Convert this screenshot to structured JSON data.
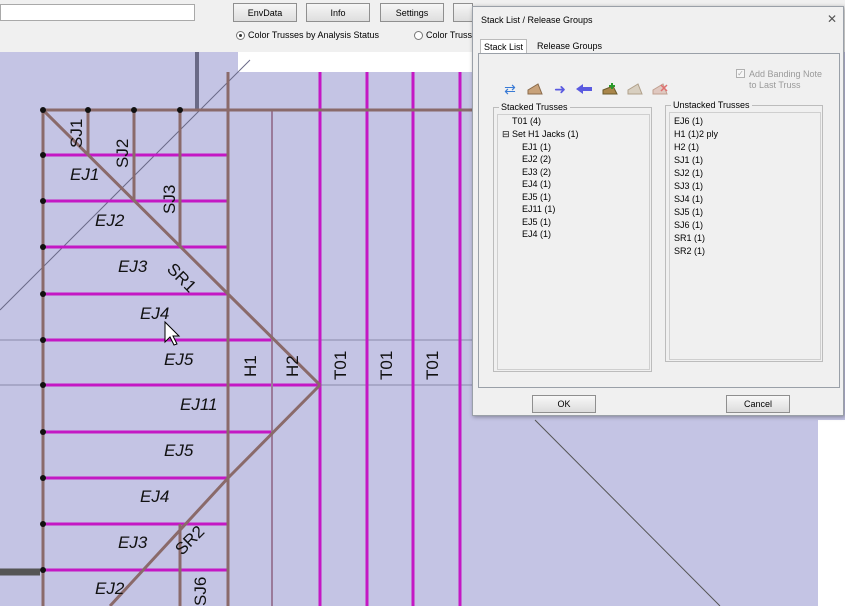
{
  "toolbar": {
    "search_value": "",
    "buttons": [
      "EnvData",
      "Info",
      "Settings"
    ],
    "radio_analysis": "Color Trusses by Analysis Status",
    "radio_other": "Color Truss"
  },
  "canvas": {
    "colors": {
      "background": "#c4c4e4",
      "truss_line": "#c418c4",
      "frame_line": "#8a6a6a",
      "node": "#111111"
    },
    "left_labels": [
      "EJ1",
      "EJ2",
      "EJ3",
      "EJ4",
      "EJ5",
      "EJ11",
      "EJ5",
      "EJ4",
      "EJ3",
      "EJ2"
    ],
    "vertical_labels": [
      "SJ1",
      "SJ2",
      "SJ3",
      "SR1",
      "H1",
      "H2",
      "T01",
      "T01",
      "T01",
      "SR2",
      "SJ6"
    ]
  },
  "dialog": {
    "title": "Stack List / Release Groups",
    "close": "✕",
    "tabs": [
      "Stack List",
      "Release Groups"
    ],
    "tools": [
      "arrows-icon",
      "truss-icon",
      "arrow-right-icon",
      "arrow-left-icon",
      "add-truss-icon",
      "truss-disabled-icon",
      "truss-remove-icon"
    ],
    "banding_note": "Add Banding Note to Last Truss",
    "stacked": {
      "title": "Stacked Trusses",
      "items": [
        "T01 (4)",
        "Set H1 Jacks (1)",
        "EJ1 (1)",
        "EJ2 (2)",
        "EJ3 (2)",
        "EJ4 (1)",
        "EJ5 (1)",
        "EJ11 (1)",
        "EJ5 (1)",
        "EJ4 (1)"
      ],
      "collapse_glyph": "⊟"
    },
    "unstacked": {
      "title": "Unstacked Trusses",
      "items": [
        "EJ6 (1)",
        "H1 (1)2 ply",
        "H2 (1)",
        "SJ1 (1)",
        "SJ2 (1)",
        "SJ3 (1)",
        "SJ4 (1)",
        "SJ5 (1)",
        "SJ6 (1)",
        "SR1 (1)",
        "SR2 (1)"
      ]
    },
    "ok": "OK",
    "cancel": "Cancel"
  }
}
